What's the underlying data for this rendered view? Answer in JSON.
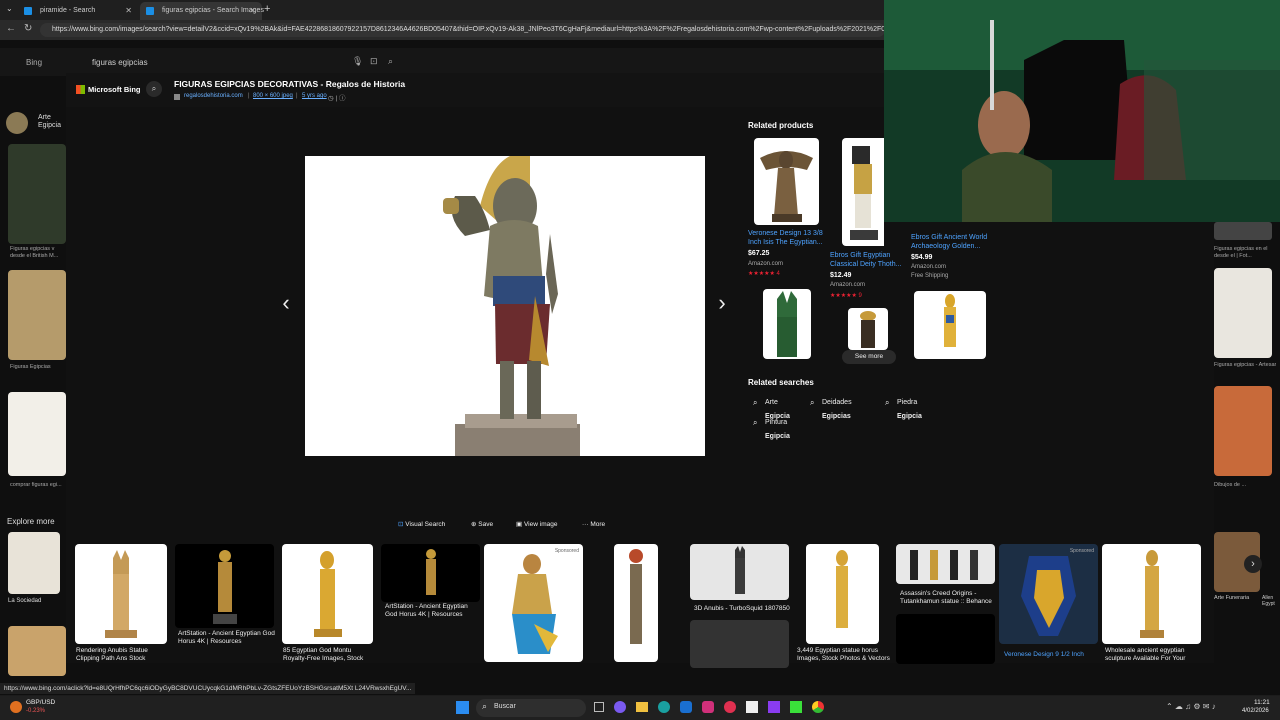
{
  "tabs": [
    {
      "label": "piramide - Search"
    },
    {
      "label": "figuras egipcias - Search Images"
    }
  ],
  "address": {
    "url": "https://www.bing.com/images/search?view=detailV2&ccid=xQv19%2BAk&id=FAE42286818607922157D8612346A4626BD05407&thid=OIP.xQv19-Ak38_JNlPeo3T6CgHaFj&mediaurl=https%3A%2F%2Fregalosdehistoria.com%2Fwp-content%2Fuploads%2F2021%2F07%"
  },
  "background_search": {
    "logo": "Bing",
    "query": "figuras egipcias",
    "left_labels": [
      "Arte Egipcia",
      "Figuras egipcias v desde el British M...",
      "Figuras Egipcias",
      "comprar figuras egi...",
      "Explore more",
      "La Sociedad"
    ],
    "right_labels": [
      "Figuras egipcias en el desde el | Fot...",
      "Figuras egipcias - Artesania",
      "Dibujos de ...",
      "Arte Funeraria",
      "Allen Egypt Sculpture"
    ]
  },
  "overlay": {
    "brand": "Microsoft Bing",
    "title": "FIGURAS EGIPCIAS DECORATIVAS - Regalos de Historia",
    "source": "regalosdehistoria.com",
    "dimensions": "800 × 600 jpeg",
    "age": "5 yrs ago",
    "related_products_label": "Related products",
    "products": [
      {
        "title": "Veronese Design 13 3/8 Inch Isis The Egyptian...",
        "price": "$67.25",
        "store": "Amazon.com",
        "rating": "★★★★★ 4"
      },
      {
        "title": "Ebros Gift Egyptian Classical Deity Thoth...",
        "price": "$12.49",
        "store": "Amazon.com",
        "rating": "★★★★★ 9"
      },
      {
        "title": "Ebros Gift Ancient World Archaeology Golden...",
        "price": "$54.99",
        "store": "Amazon.com",
        "shipping": "Free Shipping"
      }
    ],
    "see_more": "See more",
    "related_searches_label": "Related searches",
    "related_searches": [
      {
        "pre": "Arte",
        "bold": " Egipcia"
      },
      {
        "pre": "Deidades",
        "bold": " Egipcias"
      },
      {
        "pre": "Piedra",
        "bold": " Egipcia"
      },
      {
        "pre": "Pintura",
        "bold": " Egipcia"
      }
    ],
    "actions": {
      "visual_search": "Visual Search",
      "save": "Save",
      "view_image": "View image",
      "more": "More"
    },
    "strip_captions": [
      "Rendering Anubis Statue Clipping Path Ans Stock Illustration",
      "ArtStation - Ancient Egyptian God Horus 4K | Resources",
      "85 Egyptian God Montu Royalty-Free Images, Stock Photos &",
      "ArtStation - Ancient Egyptian God Horus 4K | Resources",
      "3D Anubis - TurboSquid 1807850",
      "3,449 Egyptian statue horus Images, Stock Photos & Vectors",
      "Assassin's Creed Origins - Tutankhamun statue :: Behance",
      "Veronese Design 9 1/2 Inch",
      "Wholesale ancient egyptian sculpture Available For Your"
    ],
    "sponsored": "Sponsored"
  },
  "status_url": "https://www.bing.com/aclick?ld=e8UQrHfhPC6qc6iODyGyBC8DVUCUycqkG1dMRhPbLv-ZGtsZFEUoYzBSHGsrsatM5Xt L24VRwsxhEgUV...",
  "taskbar": {
    "ticker": "GBP/USD",
    "ticker_change": "-0.23%",
    "search_placeholder": "Buscar",
    "time": "11:21",
    "date": "4/02/2026"
  },
  "colors": {
    "accent": "#4ea3ff",
    "overlay_bg": "#111111",
    "stars": "#e23333"
  }
}
